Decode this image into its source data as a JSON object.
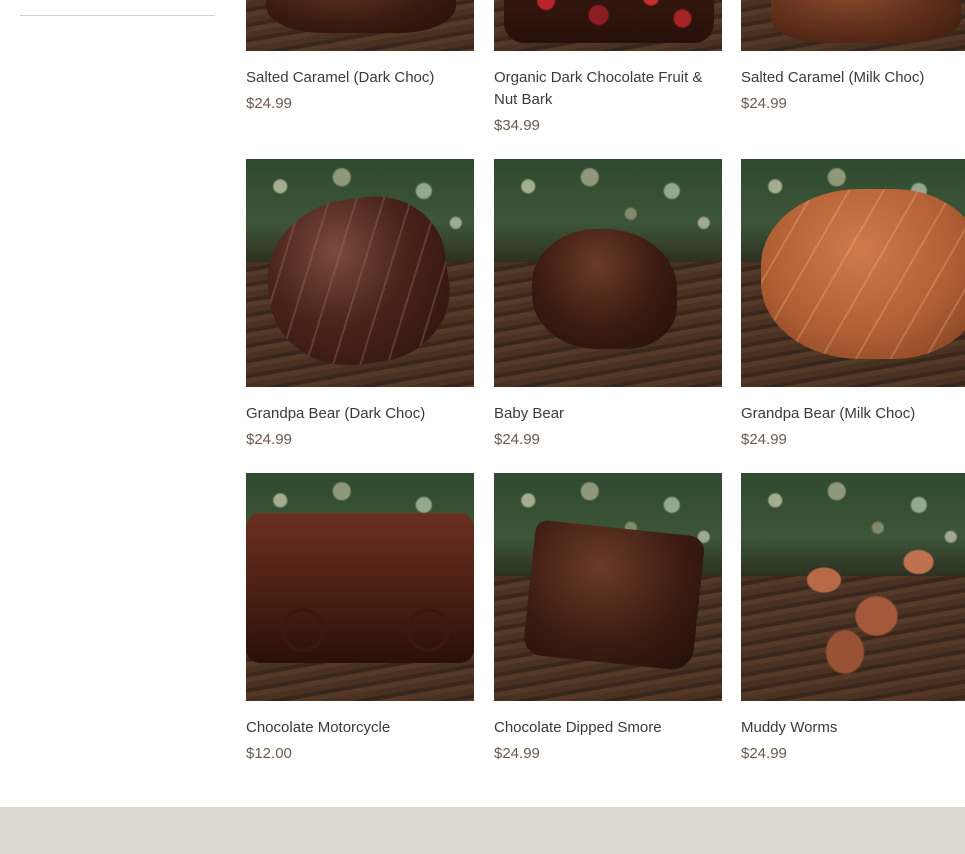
{
  "products": [
    {
      "title": "Salted Caramel (Dark Choc)",
      "price": "$24.99"
    },
    {
      "title": "Organic Dark Chocolate Fruit & Nut Bark",
      "price": "$34.99"
    },
    {
      "title": "Salted Caramel (Milk Choc)",
      "price": "$24.99"
    },
    {
      "title": "Grandpa Bear (Dark Choc)",
      "price": "$24.99"
    },
    {
      "title": "Baby Bear",
      "price": "$24.99"
    },
    {
      "title": "Grandpa Bear (Milk Choc)",
      "price": "$24.99"
    },
    {
      "title": "Chocolate Motorcycle",
      "price": "$12.00"
    },
    {
      "title": "Chocolate Dipped Smore",
      "price": "$24.99"
    },
    {
      "title": "Muddy Worms",
      "price": "$24.99"
    }
  ],
  "colors": {
    "text": "#3a3a3a",
    "price": "#6b5a4c",
    "footer_band": "#dcd8d0",
    "divider": "#cfcfcf"
  }
}
